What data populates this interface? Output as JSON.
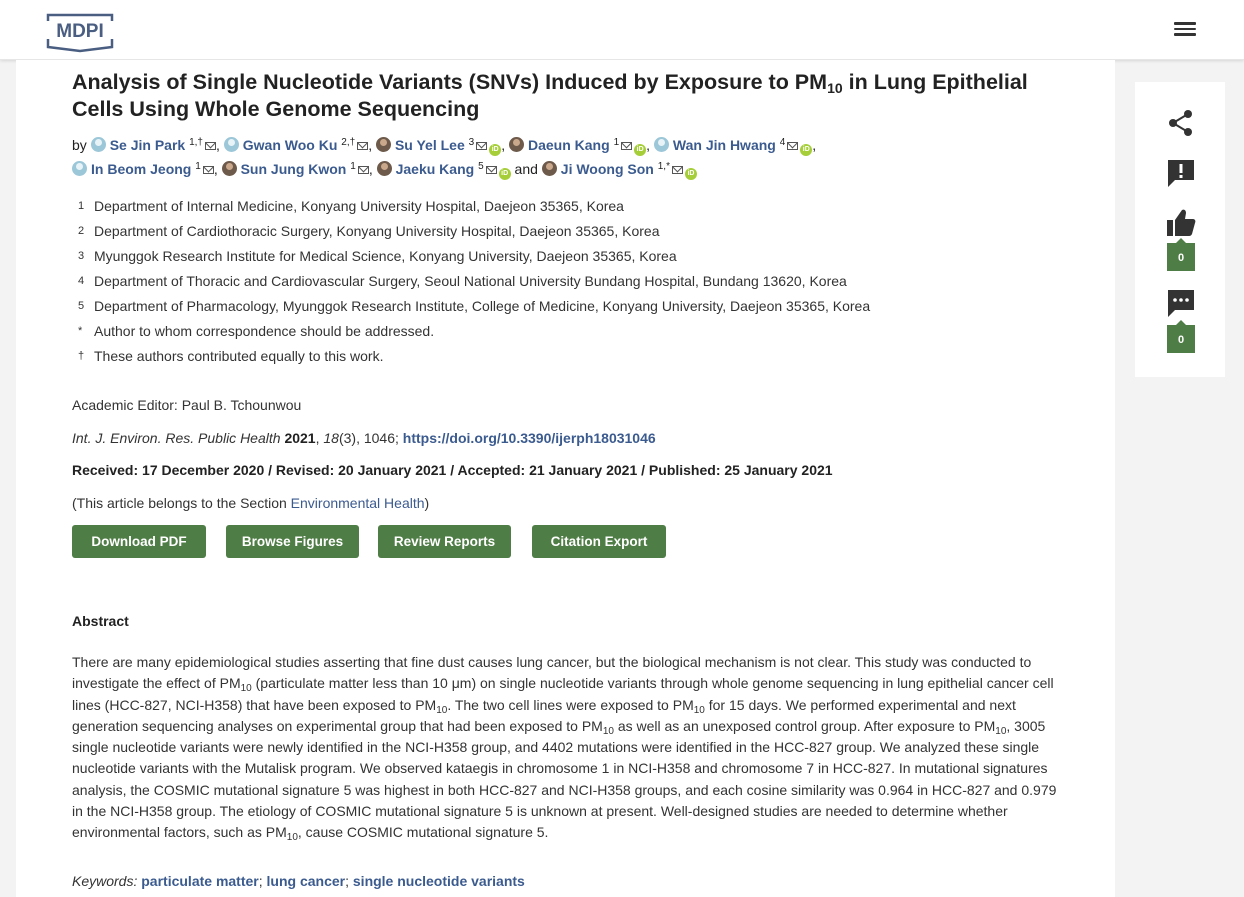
{
  "header": {
    "logo_text": "MDPI",
    "menu_icon": "hamburger-menu-icon"
  },
  "article": {
    "title_part1": "Analysis of Single Nucleotide Variants (SNVs) Induced by Exposure to PM",
    "title_sub": "10",
    "title_part2": " in Lung Epithelial Cells Using Whole Genome Sequencing",
    "by_label": "by",
    "authors": [
      {
        "name": "Se Jin Park",
        "sup": "1,†",
        "orcid": false
      },
      {
        "name": "Gwan Woo Ku",
        "sup": "2,†",
        "orcid": false
      },
      {
        "name": "Su Yel Lee",
        "sup": "3",
        "orcid": true
      },
      {
        "name": "Daeun Kang",
        "sup": "1",
        "orcid": true
      },
      {
        "name": "Wan Jin Hwang",
        "sup": "4",
        "orcid": true
      },
      {
        "name": "In Beom Jeong",
        "sup": "1",
        "orcid": false
      },
      {
        "name": "Sun Jung Kwon",
        "sup": "1",
        "orcid": false
      },
      {
        "name": "Jaeku Kang",
        "sup": "5",
        "orcid": true
      },
      {
        "name": "Ji Woong Son",
        "sup": "1,*",
        "orcid": true
      }
    ],
    "and_label": "and",
    "affiliations": [
      {
        "mark": "1",
        "text": "Department of Internal Medicine, Konyang University Hospital, Daejeon 35365, Korea"
      },
      {
        "mark": "2",
        "text": "Department of Cardiothoracic Surgery, Konyang University Hospital, Daejeon 35365, Korea"
      },
      {
        "mark": "3",
        "text": "Myunggok Research Institute for Medical Science, Konyang University, Daejeon 35365, Korea"
      },
      {
        "mark": "4",
        "text": "Department of Thoracic and Cardiovascular Surgery, Seoul National University Bundang Hospital, Bundang 13620, Korea"
      },
      {
        "mark": "5",
        "text": "Department of Pharmacology, Myunggok Research Institute, College of Medicine, Konyang University, Daejeon 35365, Korea"
      },
      {
        "mark": "*",
        "text": "Author to whom correspondence should be addressed."
      },
      {
        "mark": "†",
        "text": "These authors contributed equally to this work."
      }
    ],
    "academic_editor": "Academic Editor: Paul B. Tchounwou",
    "citation": {
      "journal": "Int. J. Environ. Res. Public Health",
      "year": "2021",
      "volume": "18",
      "issue_pages": "(3), 1046; ",
      "doi": "https://doi.org/10.3390/ijerph18031046"
    },
    "dates": "Received: 17 December 2020 / Revised: 20 January 2021 / Accepted: 21 January 2021 / Published: 25 January 2021",
    "section_prefix": "(This article belongs to the Section ",
    "section_name": "Environmental Health",
    "section_suffix": ")",
    "buttons": {
      "download_pdf": "Download PDF",
      "browse_figures": "Browse Figures",
      "review_reports": "Review Reports",
      "citation_export": "Citation Export"
    },
    "abstract_heading": "Abstract",
    "abstract": {
      "pm": "PM",
      "sub": "10",
      "s1": "There are many epidemiological studies asserting that fine dust causes lung cancer, but the biological mechanism is not clear. This study was conducted to investigate the effect of ",
      "s2": " (particulate matter less than 10 μm) on single nucleotide variants through whole genome sequencing in lung epithelial cancer cell lines (HCC-827, NCI-H358) that have been exposed to ",
      "s3": ". The two cell lines were exposed to ",
      "s4": " for 15 days. We performed experimental and next generation sequencing analyses on experimental group that had been exposed to ",
      "s5": " as well as an unexposed control group. After exposure to ",
      "s6": ", 3005 single nucleotide variants were newly identified in the NCI-H358 group, and 4402 mutations were identified in the HCC-827 group. We analyzed these single nucleotide variants with the Mutalisk program. We observed kataegis in chromosome 1 in NCI-H358 and chromosome 7 in HCC-827. In mutational signatures analysis, the COSMIC mutational signature 5 was highest in both HCC-827 and NCI-H358 groups, and each cosine similarity was 0.964 in HCC-827 and 0.979 in the NCI-H358 group. The etiology of COSMIC mutational signature 5 is unknown at present. Well-designed studies are needed to determine whether environmental factors, such as ",
      "s7": ", cause COSMIC mutational signature 5."
    },
    "keywords_label": "Keywords:",
    "keywords": [
      "particulate matter",
      "lung cancer",
      "single nucleotide variants"
    ]
  },
  "sidebar": {
    "icons": [
      "share-icon",
      "report-icon",
      "like-icon",
      "comment-icon"
    ],
    "like_count": "0",
    "comment_count": "0"
  }
}
